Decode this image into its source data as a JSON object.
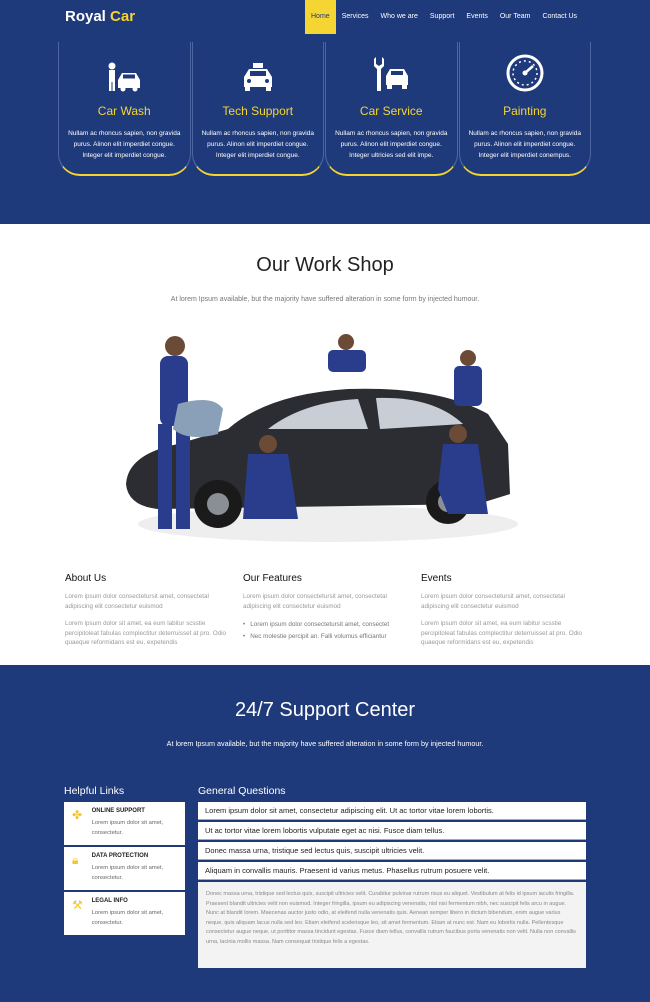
{
  "logo": {
    "part1": "Royal",
    "part2": "Car"
  },
  "nav": [
    "Home",
    "Services",
    "Who we are",
    "Support",
    "Events",
    "Our Team",
    "Contact Us"
  ],
  "services": [
    {
      "icon": "car-wash-icon",
      "title": "Car Wash",
      "text": "Nullam ac rhoncus sapien, non gravida purus. Alinon elit imperdiet congue. Integer elit imperdiet congue."
    },
    {
      "icon": "taxi-icon",
      "title": "Tech Support",
      "text": "Nullam ac rhoncus sapien, non gravida purus. Alinon elit imperdiet congue. Integer elit imperdiet congue."
    },
    {
      "icon": "wrench-car-icon",
      "title": "Car Service",
      "text": "Nullam ac rhoncus sapien, non gravida purus. Alinon elit imperdiet congue. Integer ultricies sed elit impe."
    },
    {
      "icon": "speedometer-icon",
      "title": "Painting",
      "text": "Nullam ac rhoncus sapien, non gravida purus. Alinon elit imperdiet congue. Integer elit imperdiet conempus."
    }
  ],
  "workshop": {
    "title": "Our Work Shop",
    "subtitle": "At lorem Ipsum available, but the majority have suffered alteration in some form by injected humour.",
    "about": {
      "title": "About Us",
      "p1": "Lorem ipsum dolor consectetursit amet, consectetal adipiscing elit consectetur euismod",
      "p2": "Lorem ipsum dolor sit amet, ea eum labitur scsstie percipitoleat fabulas complectitur deterruisset at pro. Odio quaeque reformidans est eu, expetendis"
    },
    "features": {
      "title": "Our Features",
      "p1": "Lorem ipsum dolor consectetursit amet, consectetal adipiscing elit consectetur euismod",
      "items": [
        "Lorem ipsum dolor consectetursit amet, consectet",
        "Nec molestie percipit an. Falli volumus efficiantur"
      ]
    },
    "events": {
      "title": "Events",
      "p1": "Lorem ipsum dolor consectetursit amet, consectetal adipiscing elit consectetur euismod",
      "p2": "Lorem ipsum dolor sit amet, ea eum labitur scsstie percipitoleat fabulas complectitur deterruisset at pro. Odio quaeque reformidans est eu, expetendis"
    }
  },
  "support": {
    "title": "24/7 Support Center",
    "subtitle": "At lorem Ipsum available, but the majority have suffered alteration in some form by injected humour.",
    "links_title": "Helpful Links",
    "links": [
      {
        "icon": "puzzle-icon",
        "title": "ONLINE SUPPORT",
        "text": "Lorem ipsum dolor sit amet, consectetur."
      },
      {
        "icon": "lock-icon",
        "title": "DATA PROTECTION",
        "text": "Lorem ipsum dolor sit amet, consectetur."
      },
      {
        "icon": "hammer-icon",
        "title": "LEGAL INFO",
        "text": "Lorem ipsum dolor sit amet, consectetur."
      }
    ],
    "questions_title": "General Questions",
    "questions": [
      "Lorem ipsum dolor sit amet, consectetur adipiscing elit. Ut ac tortor vitae lorem lobortis.",
      "Ut ac tortor vitae lorem lobortis vulputate eget ac nisi. Fusce diam tellus.",
      "Donec massa urna, tristique sed lectus quis, suscipit ultricies velit.",
      "Aliquam in convallis mauris. Praesent id varius metus. Phasellus rutrum posuere velit."
    ],
    "answer": "Donec massa urna, tristique sed lectus quis, suscipit ultricies velit. Curabitur pulvinar rutrum risus eu aliquet. Vestibulum at felis id ipsum iaculis fringilla. Praesent blandit ultricies velit non euismod. Integer fringilla, ipsum eu adipiscing venenatis, nisl nisi fermentum nibh, nec suscipit felis arcu in augue. Nunc at blandit lorem. Maecenas auctor justo odio, at eleifend nulla venenatis quis. Aenean semper libero in dictum bibendum, enim augue varius neque, quis aliquam lacus nulla sed leo. Etiam eleifend scelerisque leo, sit amet fermentum. Etiam at nunc est. Nam eu lobortis nulla. Pellentesque consectetur augue neque, ut porttitor massa tincidunt egestas. Fusce diam tellus, convallis rutrum faucibus porta venenatis non velit. Nulla non convallis urna, lacinia mollis massa. Nam consequat tristique felis a egestas."
  }
}
